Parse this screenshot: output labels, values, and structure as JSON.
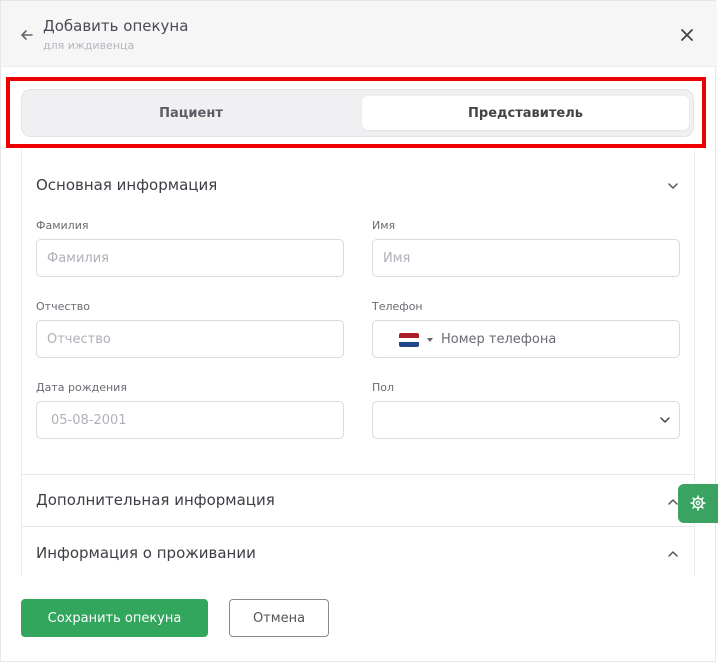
{
  "header": {
    "title": "Добавить опекуна",
    "subtitle": "для иждивенца"
  },
  "tabs": [
    {
      "label": "Пациент",
      "active": false
    },
    {
      "label": "Представитель",
      "active": true
    }
  ],
  "sections": {
    "basic": {
      "title": "Основная информация",
      "expanded": true,
      "fields": {
        "last_name": {
          "label": "Фамилия",
          "placeholder": "Фамилия",
          "value": ""
        },
        "first_name": {
          "label": "Имя",
          "placeholder": "Имя",
          "value": ""
        },
        "middle_name": {
          "label": "Отчество",
          "placeholder": "Отчество",
          "value": ""
        },
        "phone": {
          "label": "Телефон",
          "placeholder": "Номер телефона",
          "value": "",
          "country_flag": "netherlands-flag"
        },
        "birth_date": {
          "label": "Дата рождения",
          "placeholder": "05-08-2001",
          "value": ""
        },
        "gender": {
          "label": "Пол",
          "value": ""
        }
      }
    },
    "additional": {
      "title": "Дополнительная информация",
      "expanded": false
    },
    "residence": {
      "title": "Информация о проживании",
      "expanded": false
    }
  },
  "buttons": {
    "save": "Сохранить опекуна",
    "cancel": "Отмена"
  },
  "icons": {
    "back": "arrow-left-icon",
    "close": "close-icon",
    "settings": "gear-icon"
  },
  "colors": {
    "accent": "#33a65d",
    "highlight": "#ee0000",
    "header_bg": "#f6f6f7"
  }
}
